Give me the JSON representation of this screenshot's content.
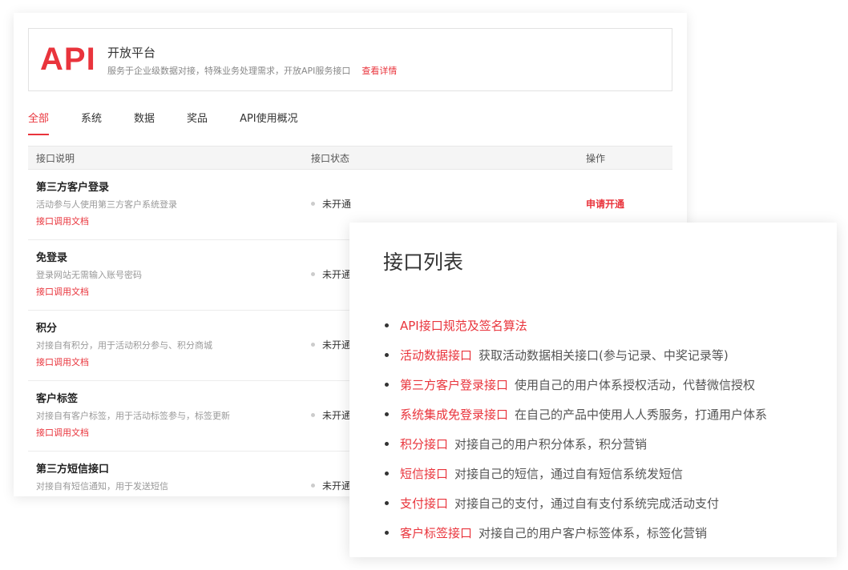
{
  "banner": {
    "logo": "API",
    "title": "开放平台",
    "desc": "服务于企业级数据对接，特殊业务处理需求，开放API服务接口",
    "link": "查看详情"
  },
  "tabs": [
    {
      "label": "全部",
      "active": true
    },
    {
      "label": "系统"
    },
    {
      "label": "数据"
    },
    {
      "label": "奖品"
    },
    {
      "label": "API使用概况"
    }
  ],
  "table": {
    "headers": [
      "接口说明",
      "接口状态",
      "操作"
    ],
    "rows": [
      {
        "name": "第三方客户登录",
        "desc": "活动参与人使用第三方客户系统登录",
        "doc": "接口调用文档",
        "status": "未开通",
        "action": "申请开通"
      },
      {
        "name": "免登录",
        "desc": "登录网站无需输入账号密码",
        "doc": "接口调用文档",
        "status": "未开通"
      },
      {
        "name": "积分",
        "desc": "对接自有积分，用于活动积分参与、积分商城",
        "doc": "接口调用文档",
        "status": "未开通"
      },
      {
        "name": "客户标签",
        "desc": "对接自有客户标签，用于活动标签参与，标签更新",
        "doc": "接口调用文档",
        "status": "未开通"
      },
      {
        "name": "第三方短信接口",
        "desc": "对接自有短信通知，用于发送短信",
        "doc": "",
        "status": "未开通"
      }
    ]
  },
  "api_list": {
    "title": "接口列表",
    "items": [
      {
        "name": "API接口规范及签名算法",
        "desc": ""
      },
      {
        "name": "活动数据接口",
        "desc": "获取活动数据相关接口(参与记录、中奖记录等)"
      },
      {
        "name": "第三方客户登录接口",
        "desc": "使用自己的用户体系授权活动，代替微信授权"
      },
      {
        "name": "系统集成免登录接口",
        "desc": "在自己的产品中使用人人秀服务，打通用户体系"
      },
      {
        "name": "积分接口",
        "desc": "对接自己的用户积分体系，积分营销"
      },
      {
        "name": "短信接口",
        "desc": "对接自己的短信，通过自有短信系统发短信"
      },
      {
        "name": "支付接口",
        "desc": "对接自己的支付，通过自有支付系统完成活动支付"
      },
      {
        "name": "客户标签接口",
        "desc": "对接自己的用户客户标签体系，标签化营销"
      }
    ]
  },
  "colors": {
    "accent": "#e9343c",
    "text": "#333333",
    "muted": "#999999"
  }
}
